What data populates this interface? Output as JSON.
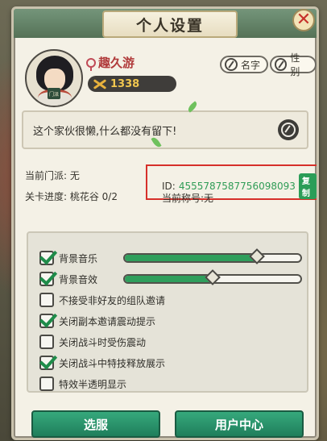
{
  "window": {
    "title": "个人设置",
    "close_symbol": "✕"
  },
  "profile": {
    "name": "趣久游",
    "power": "1338",
    "avatar_badge": "门派",
    "buttons": {
      "rename": "名字",
      "gender": "性别"
    },
    "signature": "这个家伙很懒,什么都没有留下!"
  },
  "info": {
    "sect_label": "当前门派: 无",
    "stage_label": "关卡进度: 桃花谷 0/2",
    "id_prefix": "ID:",
    "id_value": "4555787587756098093",
    "copy_label": "复制",
    "title_label": "当前称号:无"
  },
  "settings": {
    "items": [
      {
        "label": "背景音乐",
        "checked": true,
        "slider": 0.75
      },
      {
        "label": "背景音效",
        "checked": true,
        "slider": 0.5
      },
      {
        "label": "不接受非好友的组队邀请",
        "checked": false
      },
      {
        "label": "关闭副本邀请震动提示",
        "checked": true
      },
      {
        "label": "关闭战斗时受伤震动",
        "checked": false
      },
      {
        "label": "关闭战斗中特技释放展示",
        "checked": true
      },
      {
        "label": "特效半透明显示",
        "checked": false
      }
    ]
  },
  "footer": {
    "switch_server": "选服",
    "user_center": "用户中心"
  },
  "colors": {
    "accent_green": "#2f9f5c",
    "highlight_red": "#d6302a"
  }
}
